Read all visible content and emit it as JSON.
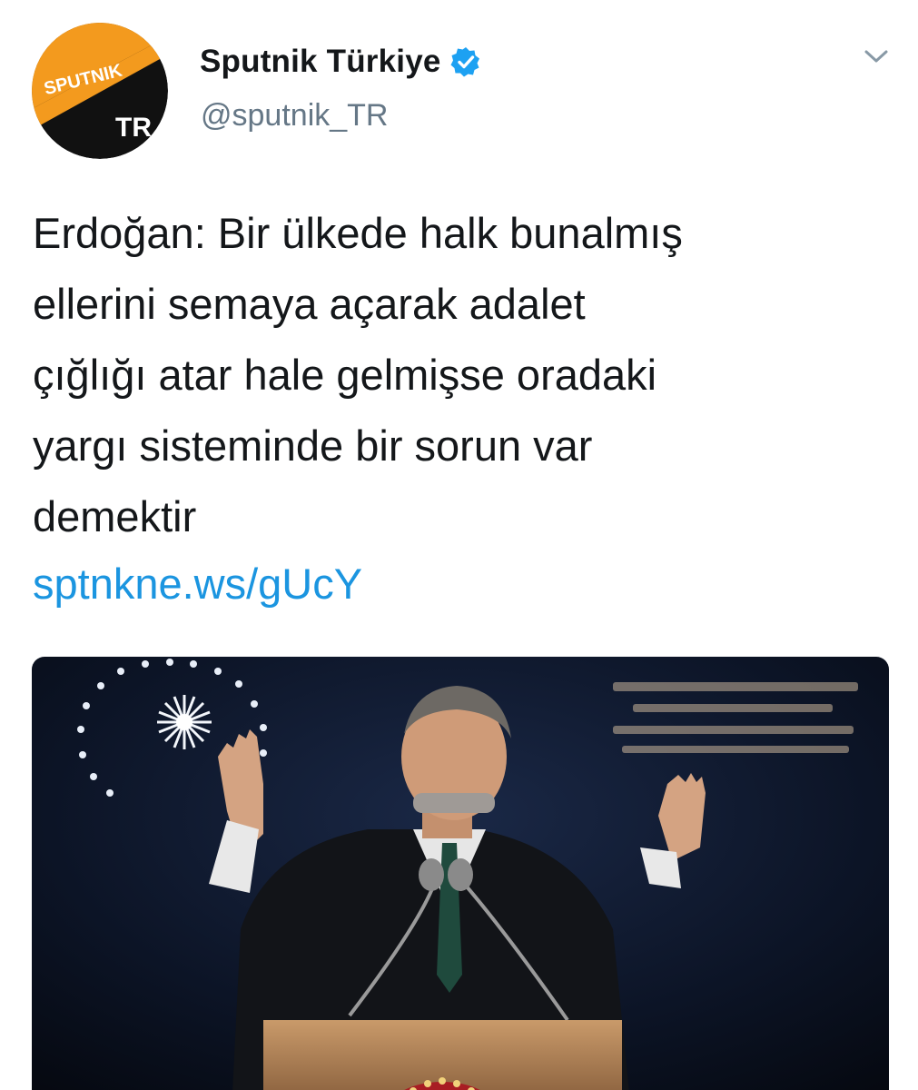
{
  "account": {
    "display_name": "Sputnik Türkiye",
    "handle": "@sputnik_TR",
    "verified": true,
    "avatar": {
      "logo_text": "SPUTNIK",
      "region_text": "TR",
      "colors": {
        "orange": "#f39a1e",
        "black": "#111111"
      }
    }
  },
  "tweet": {
    "text": "Erdoğan: Bir ülkede halk bunalmış\nellerini semaya açarak adalet\nçığlığı atar hale gelmişse oradaki\nyargı sisteminde bir sorun var\ndemektir",
    "link": "sptnkne.ws/gUcY"
  },
  "media": {
    "type": "photo",
    "description_icon": "photo-speaker-podium"
  },
  "icons": {
    "verified": "verified-badge-icon",
    "more": "chevron-down-icon"
  },
  "colors": {
    "text": "#14171a",
    "secondary": "#657786",
    "link": "#1b95e0",
    "verified": "#1da1f2"
  }
}
